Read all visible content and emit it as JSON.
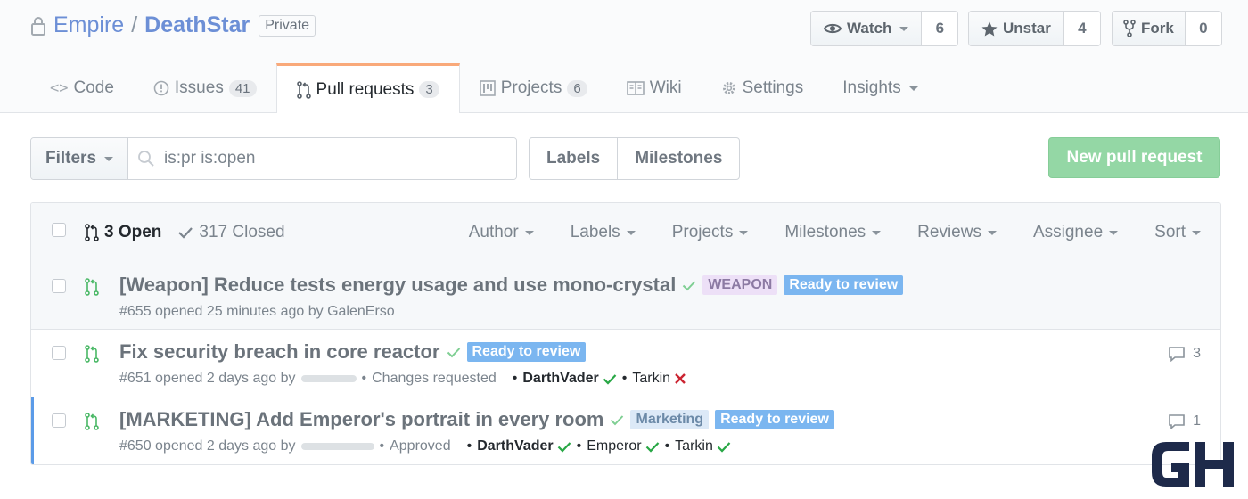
{
  "repo": {
    "owner": "Empire",
    "name": "DeathStar",
    "visibility": "Private"
  },
  "social": {
    "watch_label": "Watch",
    "watch_count": "6",
    "star_label": "Unstar",
    "star_count": "4",
    "fork_label": "Fork",
    "fork_count": "0"
  },
  "tabs": [
    {
      "label": "Code",
      "count": null
    },
    {
      "label": "Issues",
      "count": "41"
    },
    {
      "label": "Pull requests",
      "count": "3"
    },
    {
      "label": "Projects",
      "count": "6"
    },
    {
      "label": "Wiki",
      "count": null
    },
    {
      "label": "Settings",
      "count": null
    },
    {
      "label": "Insights",
      "count": null
    }
  ],
  "subnav": {
    "filters_label": "Filters",
    "search_value": "is:pr is:open",
    "labels_label": "Labels",
    "milestones_label": "Milestones",
    "new_pr_label": "New pull request"
  },
  "list_header": {
    "open_label": "3 Open",
    "closed_label": "317 Closed",
    "filters": [
      "Author",
      "Labels",
      "Projects",
      "Milestones",
      "Reviews",
      "Assignee",
      "Sort"
    ]
  },
  "pulls": [
    {
      "title": "[Weapon] Reduce tests energy usage and use mono-crystal",
      "labels": [
        "WEAPON",
        "Ready to review"
      ],
      "meta": "#655 opened 25 minutes ago by GalenErso"
    },
    {
      "title": "Fix security breach in core reactor",
      "labels": [
        "Ready to review"
      ],
      "meta": "#651 opened 2 days ago by",
      "review_status": "Changes requested",
      "reviewers": [
        "DarthVader",
        "Tarkin"
      ],
      "comments": "3"
    },
    {
      "title": "[MARKETING] Add Emperor's portrait in every room",
      "labels": [
        "Marketing",
        "Ready to review"
      ],
      "meta": "#650 opened 2 days ago by",
      "review_status": "Approved",
      "reviewers": [
        "DarthVader",
        "Emperor",
        "Tarkin"
      ],
      "comments": "1"
    }
  ],
  "colors": {
    "accent_link": "#6c8fd6",
    "tab_underline": "#f9a97a",
    "open_green": "#28a745",
    "reject_red": "#cb2431",
    "ready_label": "#7bb6f0"
  }
}
